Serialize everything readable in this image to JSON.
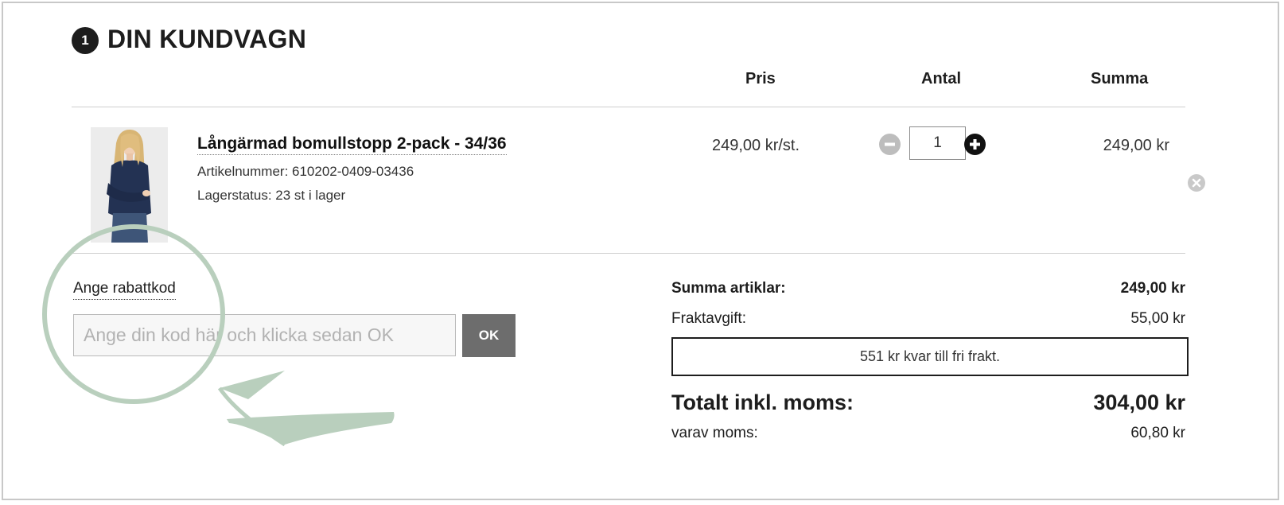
{
  "cart": {
    "step_number": "1",
    "title": "DIN KUNDVAGN",
    "columns": {
      "price": "Pris",
      "quantity": "Antal",
      "sum": "Summa"
    },
    "items": [
      {
        "name": "Långärmad bomullstopp 2-pack - 34/36",
        "article_number": "Artikelnummer: 610202-0409-03436",
        "stock_status": "Lagerstatus: 23 st i lager",
        "unit_price": "249,00 kr/st.",
        "quantity": "1",
        "line_total": "249,00 kr"
      }
    ]
  },
  "coupon": {
    "label": "Ange rabattkod",
    "placeholder": "Ange din kod här och klicka sedan OK",
    "submit_label": "OK"
  },
  "summary": {
    "articles_label": "Summa artiklar:",
    "articles_value": "249,00 kr",
    "freight_label": "Fraktavgift:",
    "freight_value": "55,00 kr",
    "free_shipping_notice": "551 kr kvar till fri frakt.",
    "total_label": "Totalt inkl. moms:",
    "total_value": "304,00 kr",
    "vat_label": "varav moms:",
    "vat_value": "60,80 kr"
  },
  "icons": {
    "step": "step-number-badge",
    "minus": "minus-circle-icon",
    "plus": "plus-circle-icon",
    "remove": "close-circle-icon",
    "annotation": "highlight-circle-arrow"
  },
  "colors": {
    "annotation": "#b9cfbd",
    "ok_button": "#6d6d6d",
    "text": "#1d1d1d"
  }
}
